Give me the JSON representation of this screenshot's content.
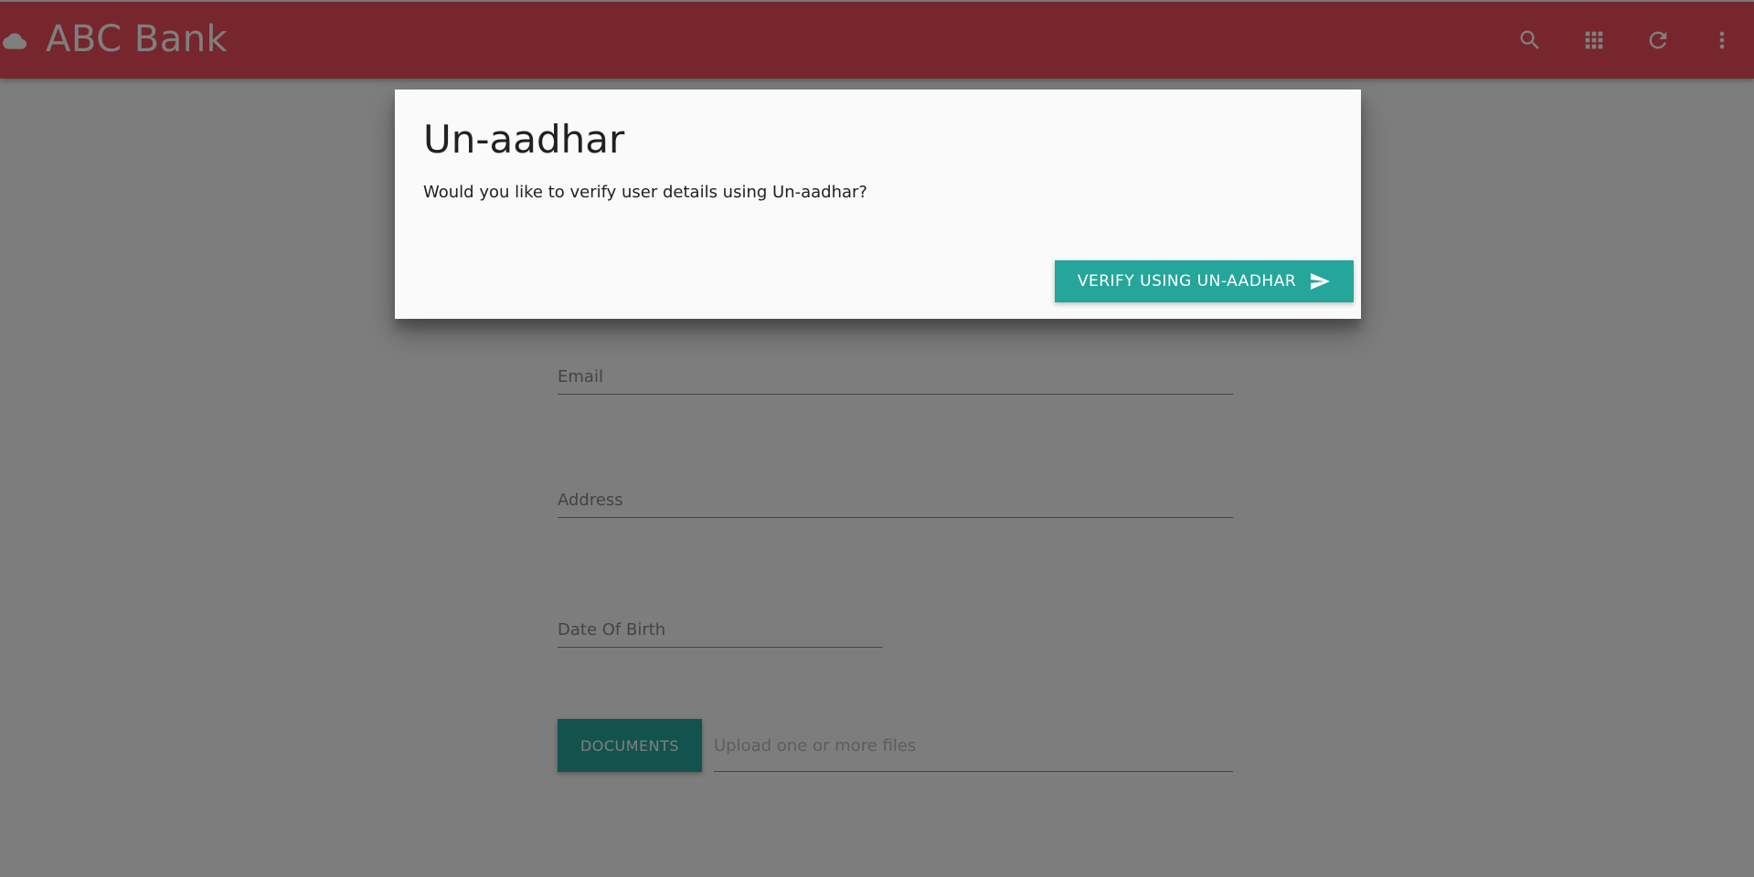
{
  "header": {
    "title": "ABC Bank",
    "brand_icon": "cloud-icon",
    "actions": [
      {
        "name": "search-icon"
      },
      {
        "name": "apps-icon"
      },
      {
        "name": "refresh-icon"
      },
      {
        "name": "more-vert-icon"
      }
    ],
    "color": "#ee4d5a"
  },
  "form": {
    "email_label": "Email",
    "address_label": "Address",
    "dob_label": "Date Of Birth",
    "documents_button": "DOCUMENTS",
    "file_placeholder": "Upload one or more files"
  },
  "modal": {
    "title": "Un-aadhar",
    "text": "Would you like to verify user details using Un-aadhar?",
    "verify_button": "VERIFY USING UN-AADHAR",
    "verify_icon": "send-icon",
    "accent": "#26a69a"
  }
}
